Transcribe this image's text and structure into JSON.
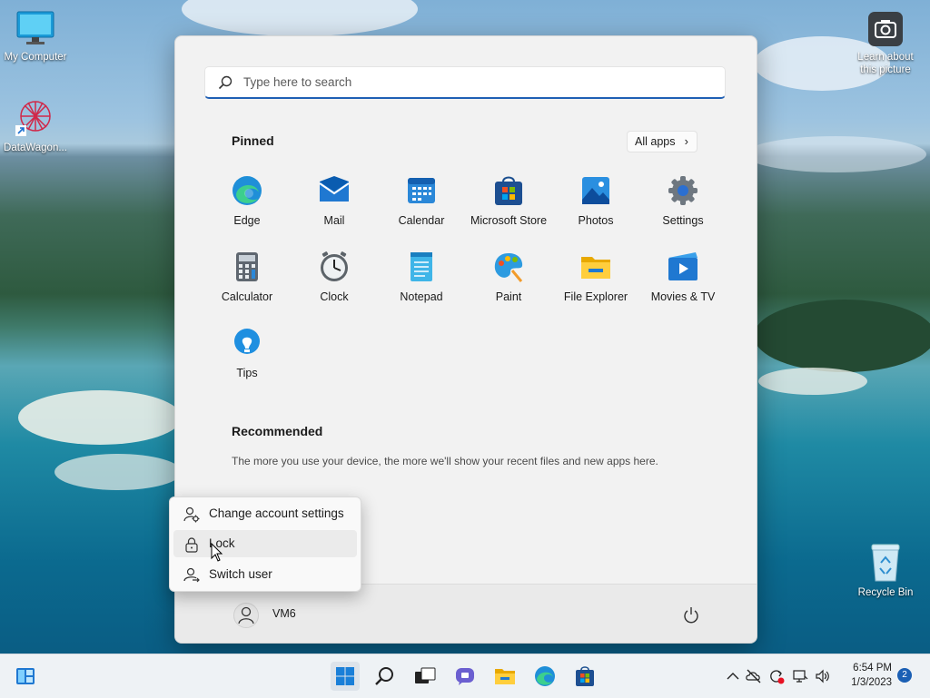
{
  "desktop": {
    "icons": [
      {
        "label": "My Computer",
        "icon": "monitor-icon"
      },
      {
        "label": "DataWagon...",
        "icon": "datawagon-shortcut-icon"
      },
      {
        "label": "Learn about this picture",
        "icon": "camera-icon"
      },
      {
        "label": "Recycle Bin",
        "icon": "recycle-bin-icon"
      }
    ]
  },
  "start_menu": {
    "search_placeholder": "Type here to search",
    "pinned_title": "Pinned",
    "all_apps_label": "All apps",
    "pinned_apps": [
      {
        "label": "Edge",
        "icon": "edge-icon"
      },
      {
        "label": "Mail",
        "icon": "mail-icon"
      },
      {
        "label": "Calendar",
        "icon": "calendar-icon"
      },
      {
        "label": "Microsoft Store",
        "icon": "store-icon"
      },
      {
        "label": "Photos",
        "icon": "photos-icon"
      },
      {
        "label": "Settings",
        "icon": "settings-gear-icon"
      },
      {
        "label": "Calculator",
        "icon": "calculator-icon"
      },
      {
        "label": "Clock",
        "icon": "clock-icon"
      },
      {
        "label": "Notepad",
        "icon": "notepad-icon"
      },
      {
        "label": "Paint",
        "icon": "paint-icon"
      },
      {
        "label": "File Explorer",
        "icon": "folder-icon"
      },
      {
        "label": "Movies & TV",
        "icon": "movies-icon"
      },
      {
        "label": "Tips",
        "icon": "tips-bulb-icon"
      }
    ],
    "recommended_title": "Recommended",
    "recommended_text": "The more you use your device, the more we'll show your recent files and new apps here.",
    "user_name": "VM6"
  },
  "account_menu": {
    "items": [
      {
        "label": "Change account settings",
        "icon": "account-settings-icon"
      },
      {
        "label": "Lock",
        "icon": "lock-icon"
      },
      {
        "label": "Switch user",
        "icon": "switch-user-icon"
      }
    ]
  },
  "taskbar": {
    "time": "6:54 PM",
    "date": "1/3/2023",
    "notification_count": "2"
  },
  "colors": {
    "accent": "#1f5fb4",
    "menu_bg": "#f2f2f2",
    "taskbar_bg": "#eef2f5"
  }
}
